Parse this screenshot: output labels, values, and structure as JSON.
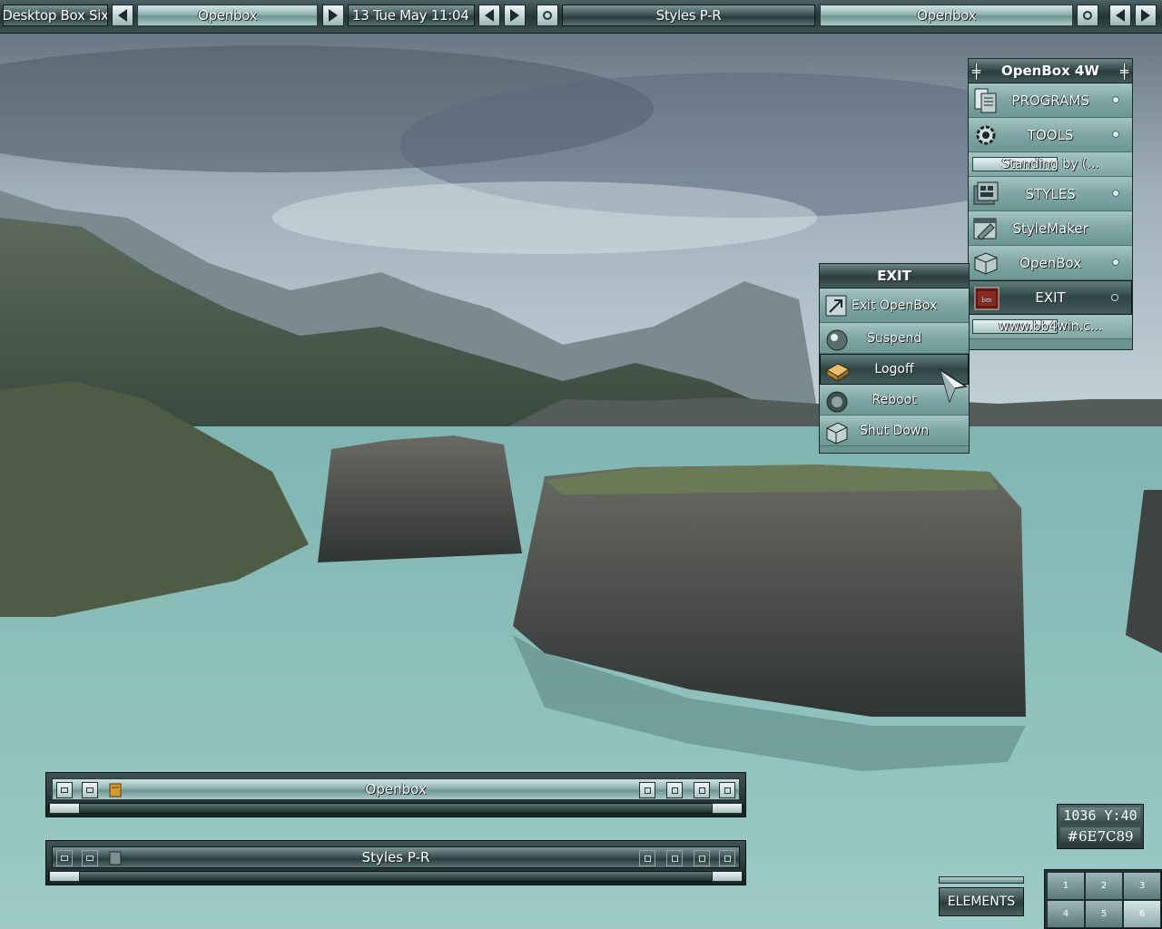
{
  "toolbar": {
    "workspace_name": "Desktop Box Six",
    "window_label": "Openbox",
    "clock": "13 Tue May 11:04",
    "style_label": "Styles P-R",
    "window_label_2": "Openbox"
  },
  "main_menu": {
    "title": "OpenBox 4W",
    "items": [
      {
        "label": "PROGRAMS"
      },
      {
        "label": "TOOLS"
      },
      {
        "label": "Standing by (..."
      },
      {
        "label": "STYLES"
      },
      {
        "label": "StyleMaker"
      },
      {
        "label": "OpenBox"
      },
      {
        "label": "EXIT"
      },
      {
        "label": "www.bb4win.c..."
      }
    ]
  },
  "exit_menu": {
    "title": "EXIT",
    "items": [
      {
        "label": "Exit OpenBox"
      },
      {
        "label": "Suspend"
      },
      {
        "label": "Logoff"
      },
      {
        "label": "Reboot"
      },
      {
        "label": "Shut Down"
      }
    ]
  },
  "windows": [
    {
      "title": "Openbox"
    },
    {
      "title": "Styles P-R"
    }
  ],
  "picker": {
    "coords": "1036 Y:40",
    "color_hex": "#6E7C89"
  },
  "elements_label": "ELEMENTS",
  "pager": {
    "pages": [
      "1",
      "2",
      "3",
      "4",
      "5",
      "6"
    ],
    "active_page": "6"
  },
  "colors": {
    "chrome_teal": "#6a9391",
    "chrome_dark": "#243434",
    "water": "#7fb5b1"
  }
}
